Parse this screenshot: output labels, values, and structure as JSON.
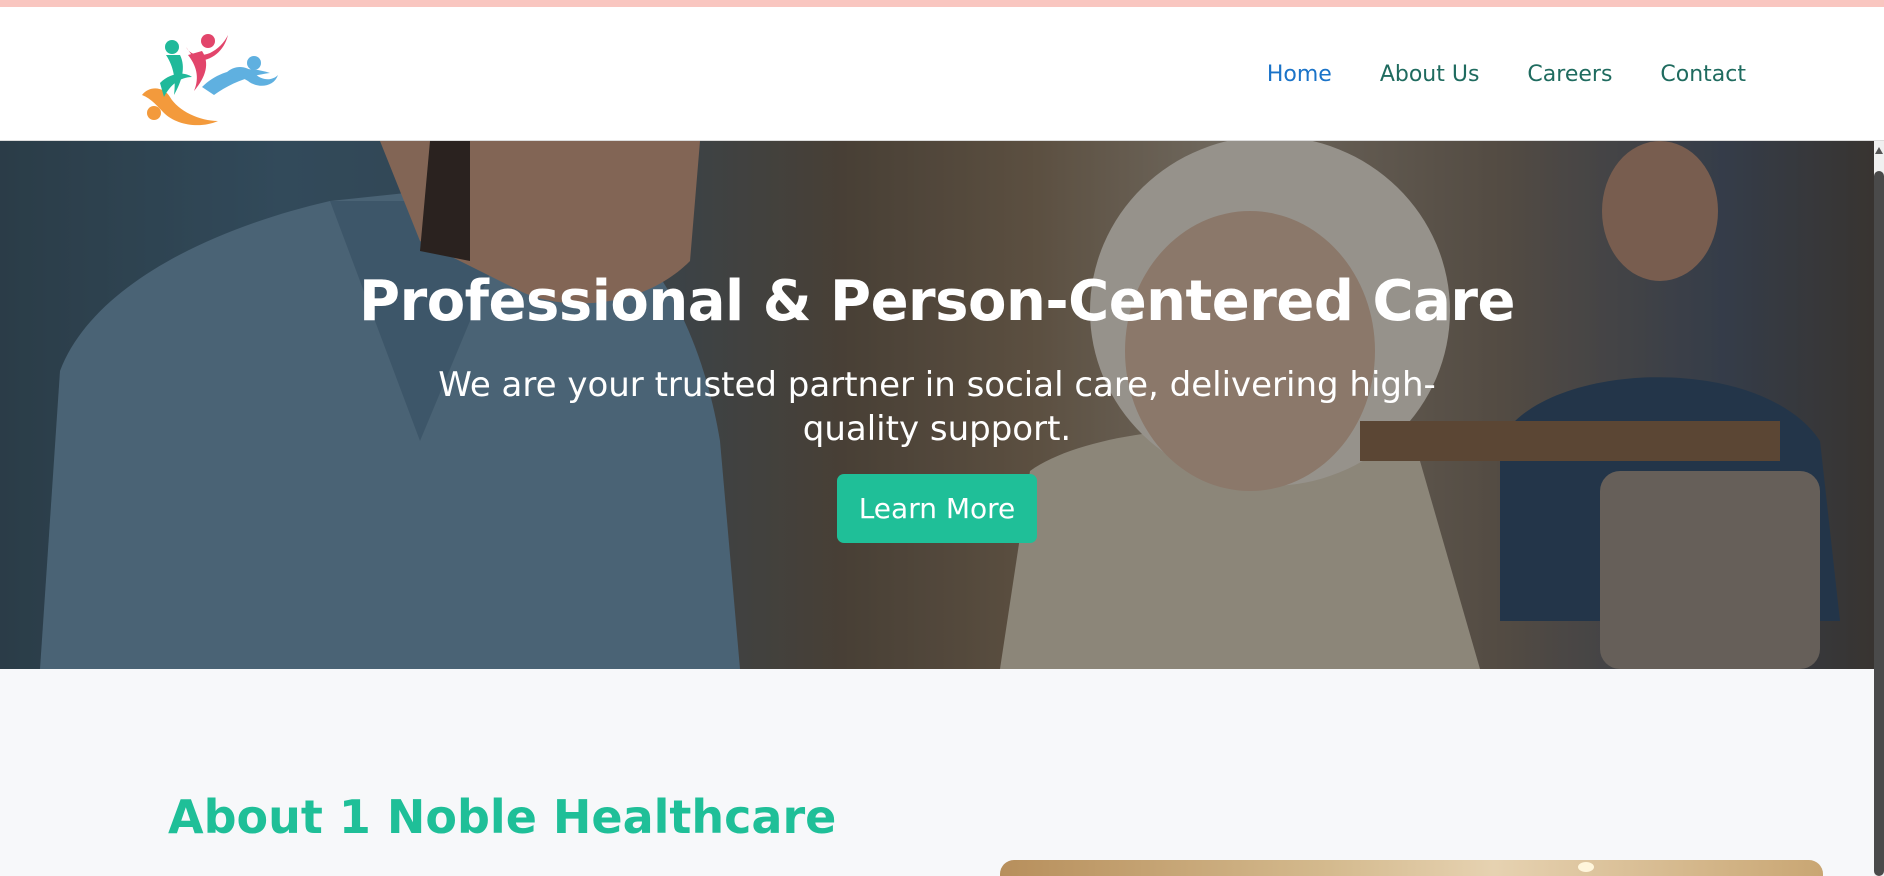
{
  "nav": {
    "logo_alt": "1 Noble Healthcare logo",
    "links": [
      {
        "label": "Home",
        "active": true
      },
      {
        "label": "About Us",
        "active": false
      },
      {
        "label": "Careers",
        "active": false
      },
      {
        "label": "Contact",
        "active": false
      }
    ]
  },
  "hero": {
    "title": "Professional & Person-Centered Care",
    "subtitle": "We are your trusted partner in social care, delivering high-quality support.",
    "cta_label": "Learn More"
  },
  "about": {
    "title": "About 1 Noble Healthcare"
  },
  "colors": {
    "brand_teal": "#1fbf98",
    "nav_text": "#1f6b5f",
    "nav_active": "#1a73c8",
    "top_strip": "#f9c6c0"
  }
}
